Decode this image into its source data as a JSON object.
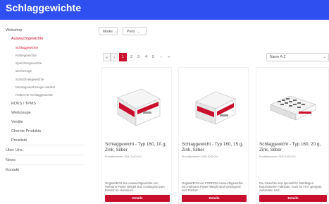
{
  "page": {
    "title": "Schlaggewichte"
  },
  "colors": {
    "header": "#2f4ff0",
    "accent": "#c8102e"
  },
  "sidebar": {
    "webshop": "Webshop",
    "auswuchtgewichte": "Auswuchtgewichte",
    "sub": [
      "Schlaggewichte",
      "Klebegewichte",
      "Speichengewichte",
      "Werkzeuge",
      "Schutzhülsgewichte",
      "Montagewerkzeuge Handel",
      "Rollen für Schlaggewichte"
    ],
    "rdks": "RDKS / TPMS",
    "werkzeuge": "Werkzeuge",
    "ventile": "Ventile",
    "chemie": "Chemie Produkte",
    "preise": "Preisliste",
    "uber_uns": "Über Uns",
    "news": "News",
    "kontakt": "Kontakt"
  },
  "filters": {
    "marke": "Marke",
    "preis": "Preis"
  },
  "pagination": {
    "first": "«",
    "prev": "‹",
    "pages": [
      "1",
      "2",
      "3",
      "4",
      "5"
    ],
    "next": "›",
    "last": "»",
    "current": "1"
  },
  "sort": {
    "value": "Name A-Z"
  },
  "products": [
    {
      "name": "Schlaggewicht - Typ 160, 10 g, Zink, Silber",
      "sub": "Produktnummer: 5160 1010 010",
      "desc": "Original/Echt des Auswuchtgewichte von Hofmann Power Weight sind vorwiegend zum Einsatz an Aluminium...",
      "button": "Details"
    },
    {
      "name": "Schlaggewicht - Typ 160, 15 g, Zink, Silber",
      "sub": "Produktnummer: 5160 1015 010",
      "desc": "Original/Echt von FORDON Auswuchtgewichte von Hofmann Power Weight sind vorwiegend zum Einsatz...",
      "button": "Details"
    },
    {
      "name": "Schlaggewicht - Typ 160, 20 g, Zink, Silber",
      "sub": "Produktnummer: 5160 1020 010",
      "desc": "Die Gewichte sind speziell für Stahlfelgen französischer Fabrikate. Auch für FIAT geeignet. Außerdem sind...",
      "button": "Details"
    }
  ]
}
